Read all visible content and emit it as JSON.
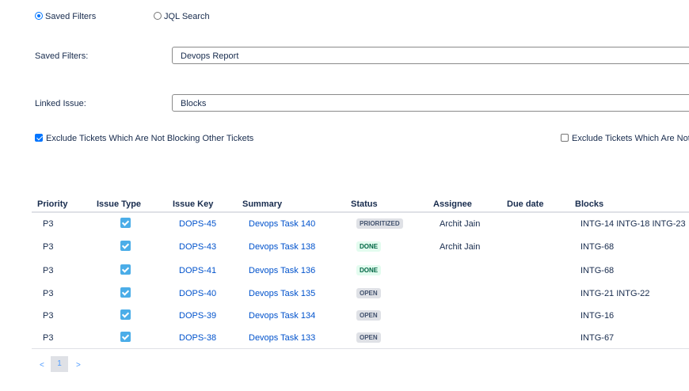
{
  "mode": {
    "saved_filters_label": "Saved Filters",
    "jql_label": "JQL Search",
    "selected": "saved_filters"
  },
  "saved_filters": {
    "label": "Saved Filters:",
    "value": "Devops Report"
  },
  "linked_issue": {
    "label": "Linked Issue:",
    "value": "Blocks"
  },
  "options": {
    "exclude_not_blocking": {
      "label": "Exclude Tickets Which Are Not Blocking Other Tickets",
      "checked": true
    },
    "exclude_second": {
      "label": "Exclude Tickets Which Are Not A",
      "checked": false
    }
  },
  "table": {
    "headers": [
      "Priority",
      "Issue Type",
      "Issue Key",
      "Summary",
      "Status",
      "Assignee",
      "Due date",
      "Blocks"
    ],
    "rows": [
      {
        "priority": "P3",
        "key": "DOPS-45",
        "summary": "Devops Task 140",
        "status": "PRIORITIZED",
        "status_type": "grey",
        "assignee": "Archit Jain",
        "due": "",
        "blocks": "INTG-14 INTG-18 INTG-23"
      },
      {
        "priority": "P3",
        "key": "DOPS-43",
        "summary": "Devops Task 138",
        "status": "DONE",
        "status_type": "green",
        "assignee": "Archit Jain",
        "due": "",
        "blocks": "INTG-68"
      },
      {
        "priority": "P3",
        "key": "DOPS-41",
        "summary": "Devops Task 136",
        "status": "DONE",
        "status_type": "green",
        "assignee": "",
        "due": "",
        "blocks": "INTG-68"
      },
      {
        "priority": "P3",
        "key": "DOPS-40",
        "summary": "Devops Task 135",
        "status": "OPEN",
        "status_type": "grey",
        "assignee": "",
        "due": "",
        "blocks": "INTG-21 INTG-22"
      },
      {
        "priority": "P3",
        "key": "DOPS-39",
        "summary": "Devops Task 134",
        "status": "OPEN",
        "status_type": "grey",
        "assignee": "",
        "due": "",
        "blocks": "INTG-16"
      },
      {
        "priority": "P3",
        "key": "DOPS-38",
        "summary": "Devops Task 133",
        "status": "OPEN",
        "status_type": "grey",
        "assignee": "",
        "due": "",
        "blocks": "INTG-67"
      }
    ]
  },
  "pagination": {
    "prev": "<",
    "current": "1",
    "next": ">"
  }
}
